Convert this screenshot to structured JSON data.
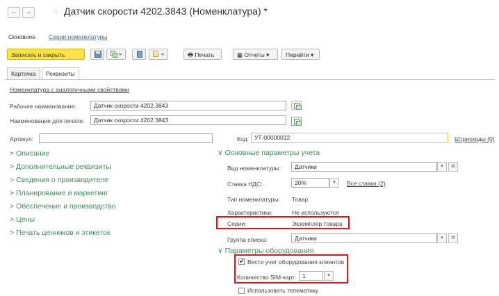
{
  "window": {
    "back_icon": "←",
    "forward_icon": "→",
    "star_icon": "☆",
    "title": "Датчик скорости 4202.3843 (Номенклатура) *"
  },
  "section_tabs": {
    "main": "Основное",
    "series": "Серии номенклатуры"
  },
  "toolbar": {
    "save_close": "Записать и закрыть",
    "print": "Печать",
    "reports": "Отчеты",
    "goto": "Перейти"
  },
  "tabs": {
    "card": "Карточка",
    "requisites": "Реквизиты"
  },
  "form": {
    "similar_link": "Номенклатура с аналогичными свойствами",
    "work_name_label": "Рабочее наименование:",
    "work_name_value": "Датчик скорости 4202.3843",
    "print_name_label": "Наименование для печати:",
    "print_name_value": "Датчик скорости 4202.3843",
    "article_label": "Артикул:",
    "article_value": "",
    "code_label": "Код:",
    "code_value": "УТ-00000012",
    "barcodes_link": "Штрихкоды (0)"
  },
  "left_groups": [
    "> Описание",
    "> Дополнительные реквизиты",
    "> Сведения о производителе",
    "> Планирование и маркетинг",
    "> Обеспечение и производство",
    "> Цены",
    "> Печать ценников и этикеток"
  ],
  "accounting": {
    "header": "∨ Основные параметры учета",
    "type_label": "Вид номенклатуры:",
    "type_value": "Датчики",
    "vat_label": "Ставка НДС:",
    "vat_value": "20%",
    "all_rates_link": "Все ставки (2)",
    "nom_type_label": "Тип номенклатуры:",
    "nom_type_value": "Товар",
    "characteristics_label": "Характеристики:",
    "characteristics_value": "Не используются",
    "series_label": "Серии:",
    "series_value": "Экземпляр товара",
    "list_group_label": "Группа списка:",
    "list_group_value": "Датчики"
  },
  "equipment": {
    "header": "∨ Параметры оборудования",
    "track_clients_label": "Вести учет оборудования клиентов",
    "track_clients_checked": true,
    "sim_label": "Количество SIM-карт:",
    "sim_value": "1",
    "telematics_label": "Использовать телематику",
    "telematics_checked": false
  },
  "colors": {
    "accent": "#fbe14a",
    "group_green": "#3f8c5c",
    "link_blue": "#2d6eb5",
    "highlight_red": "#e0141e"
  }
}
